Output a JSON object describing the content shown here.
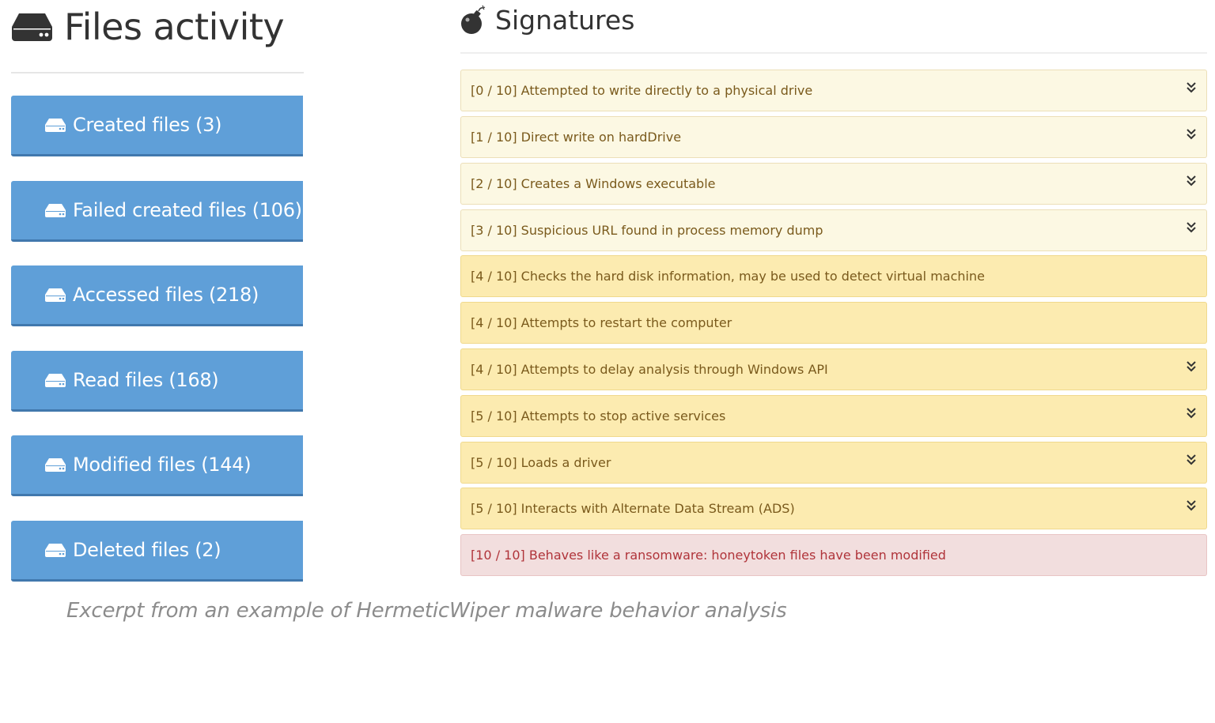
{
  "files_activity": {
    "title": "Files activity",
    "icon": "hdd-icon",
    "button_color": "#5f9fd8",
    "buttons": [
      {
        "label": "Created files (3)"
      },
      {
        "label": "Failed created files (106)"
      },
      {
        "label": "Accessed files (218)"
      },
      {
        "label": "Read files (168)"
      },
      {
        "label": "Modified files (144)"
      },
      {
        "label": "Deleted files (2)"
      }
    ]
  },
  "signatures": {
    "title": "Signatures",
    "icon": "bomb-icon",
    "items": [
      {
        "text": "[0 / 10] Attempted to write directly to a physical drive",
        "severity": "low",
        "expandable": true
      },
      {
        "text": "[1 / 10] Direct write on hardDrive",
        "severity": "low",
        "expandable": true
      },
      {
        "text": "[2 / 10] Creates a Windows executable",
        "severity": "low",
        "expandable": true
      },
      {
        "text": "[3 / 10] Suspicious URL found in process memory dump",
        "severity": "low",
        "expandable": true
      },
      {
        "text": "[4 / 10] Checks the hard disk information, may be used to detect virtual machine",
        "severity": "mid",
        "expandable": false
      },
      {
        "text": "[4 / 10] Attempts to restart the computer",
        "severity": "mid",
        "expandable": false
      },
      {
        "text": "[4 / 10] Attempts to delay analysis through Windows API",
        "severity": "mid",
        "expandable": true
      },
      {
        "text": "[5 / 10] Attempts to stop active services",
        "severity": "mid",
        "expandable": true
      },
      {
        "text": "[5 / 10] Loads a driver",
        "severity": "mid",
        "expandable": true
      },
      {
        "text": "[5 / 10] Interacts with Alternate Data Stream (ADS)",
        "severity": "mid",
        "expandable": true
      },
      {
        "text": "[10 / 10] Behaves like a ransomware: honeytoken files have been modified",
        "severity": "high",
        "expandable": false
      }
    ],
    "colors": {
      "low": "#fcf8e3",
      "mid": "#fcebb0",
      "high": "#f2dede"
    }
  },
  "caption": "Excerpt from an example of HermeticWiper malware behavior analysis"
}
